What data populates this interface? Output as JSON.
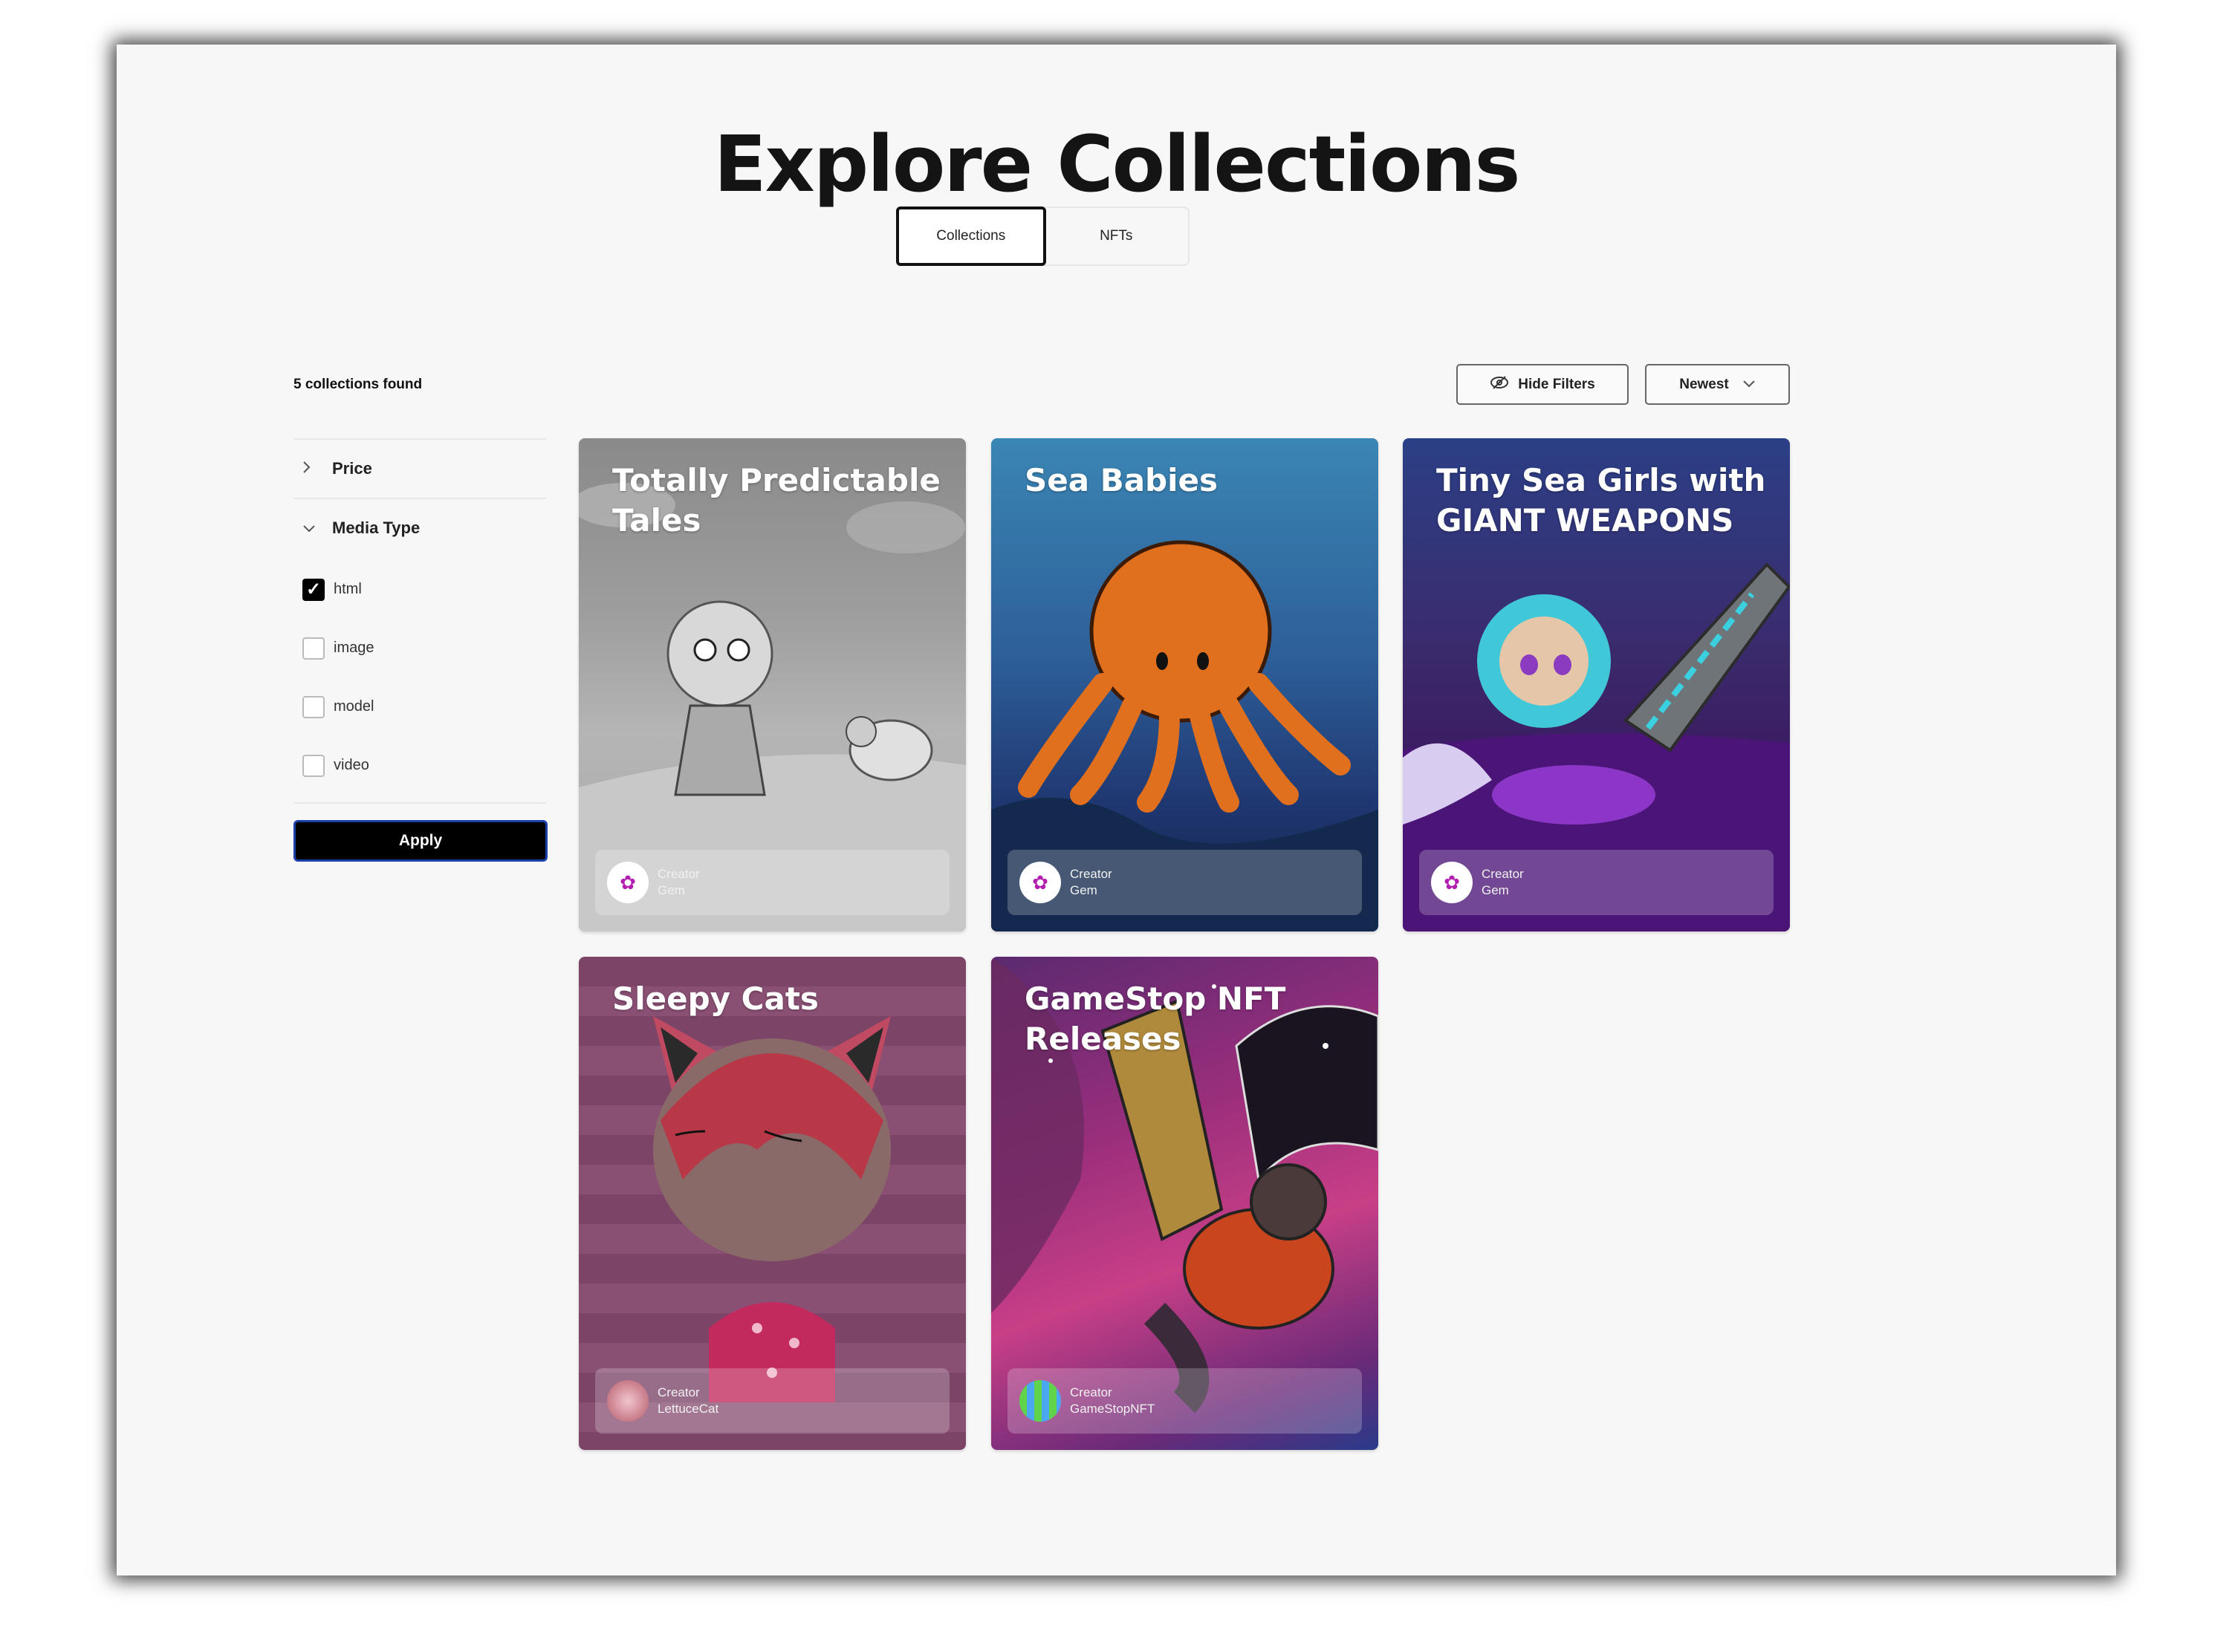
{
  "header": {
    "title": "Explore Collections"
  },
  "tabs": [
    {
      "label": "Collections",
      "active": true
    },
    {
      "label": "NFTs",
      "active": false
    }
  ],
  "results": {
    "count_label": "5 collections found"
  },
  "toolbar": {
    "hide_filters_label": "Hide Filters",
    "hide_filters_icon": "eye-off-icon",
    "sort_label": "Newest",
    "sort_icon": "chevron-down-icon"
  },
  "filters": {
    "sections": [
      {
        "label": "Price",
        "expanded": false,
        "icon": "chevron-right-icon"
      },
      {
        "label": "Media Type",
        "expanded": true,
        "icon": "chevron-down-icon"
      }
    ],
    "media_types": [
      {
        "label": "html",
        "checked": true
      },
      {
        "label": "image",
        "checked": false
      },
      {
        "label": "model",
        "checked": false
      },
      {
        "label": "video",
        "checked": false
      }
    ],
    "apply_label": "Apply"
  },
  "collections": [
    {
      "title": "Totally Predictable Tales",
      "creator_label": "Creator",
      "creator_name": "Gem",
      "theme": "grayscale-sketch"
    },
    {
      "title": "Sea Babies",
      "creator_label": "Creator",
      "creator_name": "Gem",
      "theme": "blue-ocean-octopus"
    },
    {
      "title": "Tiny Sea Girls with GIANT WEAPONS",
      "creator_label": "Creator",
      "creator_name": "Gem",
      "theme": "purple-mermaid"
    },
    {
      "title": "Sleepy Cats",
      "creator_label": "Creator",
      "creator_name": "LettuceCat",
      "theme": "pink-striped-cat"
    },
    {
      "title": "GameStop NFT Releases",
      "creator_label": "Creator",
      "creator_name": "GameStopNFT",
      "theme": "magenta-space-comic"
    }
  ],
  "colors": {
    "background": "#f7f7f7",
    "text": "#141414",
    "primary_button": "#000000",
    "apply_outline": "#1a3fa8"
  }
}
